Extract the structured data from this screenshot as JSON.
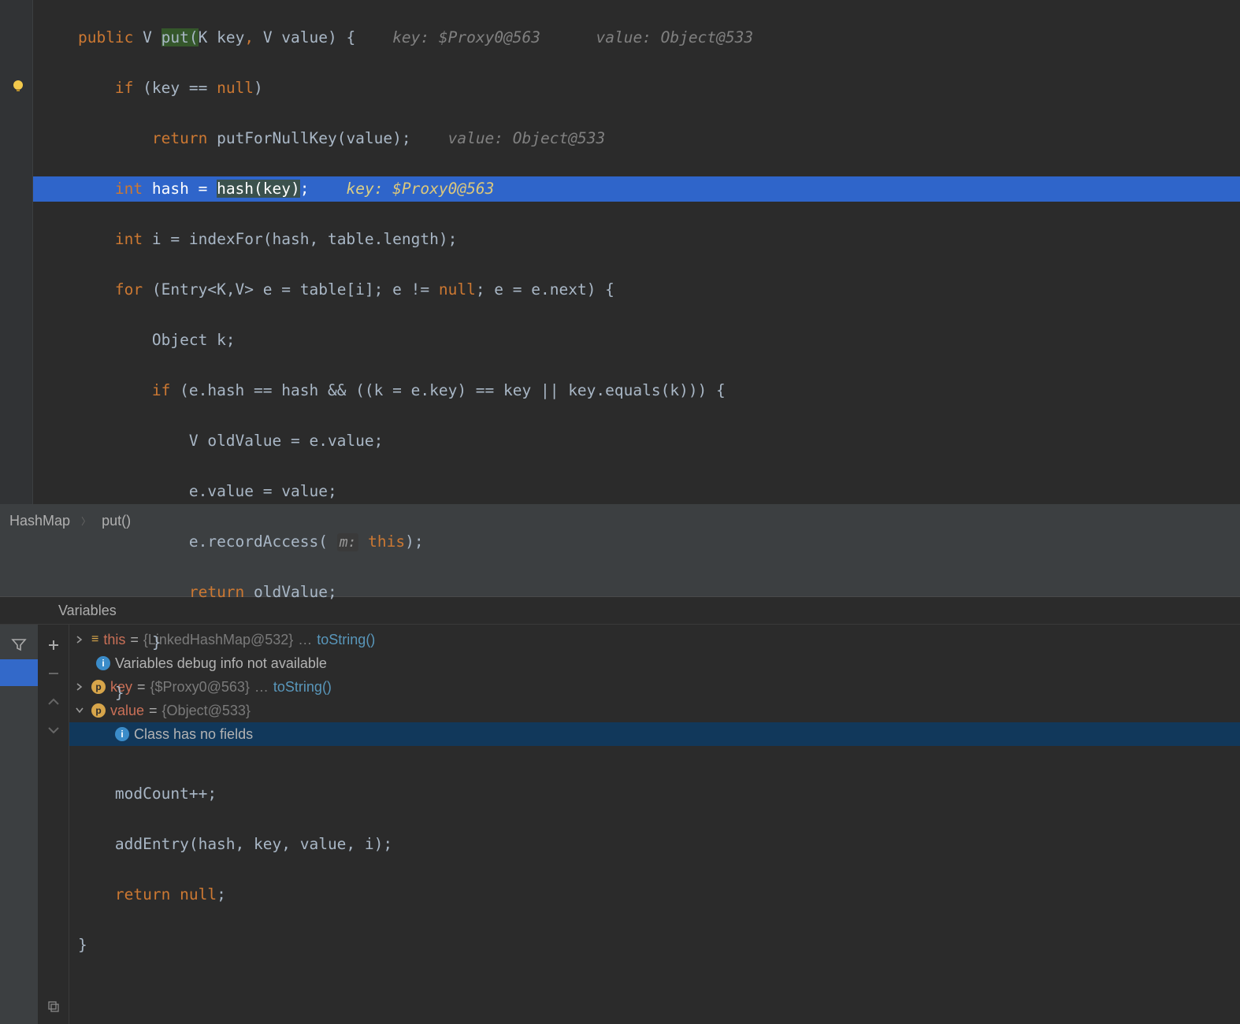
{
  "breadcrumb": {
    "class": "HashMap",
    "method": "put()"
  },
  "gutter": {
    "bulb": "suggestion-bulb"
  },
  "code": {
    "l1": {
      "pre": "    ",
      "kw": "public",
      "t1": " V ",
      "sel": "put(",
      "t2": "K key",
      "comma": ",",
      "t3": " V value) {",
      "hint1a": "key: ",
      "hint1b": "$Proxy0@563",
      "hint2a": "value: ",
      "hint2b": "Object@533"
    },
    "l2": {
      "pre": "        ",
      "kw": "if",
      "t": " (key == ",
      "kw2": "null",
      "t2": ")"
    },
    "l3": {
      "pre": "            ",
      "kw": "return",
      "t": " putForNullKey(value);",
      "hint1a": "value: ",
      "hint1b": "Object@533"
    },
    "l4": {
      "pre": "        ",
      "kw": "int",
      "t": " hash = ",
      "call": "hash(key)",
      "semi": ";",
      "hint1a": "key: ",
      "hint1b": "$Proxy0@563"
    },
    "l5": {
      "pre": "        ",
      "kw": "int",
      "t": " i = indexFor(hash, table.length);"
    },
    "l6": {
      "pre": "        ",
      "kw": "for",
      "t": " (Entry<K,V> e = table[i]; e != ",
      "kw2": "null",
      "t2": "; e = e.next) {"
    },
    "l7": {
      "pre": "            ",
      "t": "Object k;"
    },
    "l8": {
      "pre": "            ",
      "kw": "if",
      "t": " (e.hash == hash && ((k = e.key) == key || key.equals(k))) {"
    },
    "l9": {
      "pre": "                ",
      "t": "V oldValue = e.value;"
    },
    "l10": {
      "pre": "                ",
      "t": "e.value = value;"
    },
    "l11": {
      "pre": "                ",
      "t": "e.recordAccess( ",
      "param": "m:",
      "t2": " ",
      "kw": "this",
      "t3": ");"
    },
    "l12": {
      "pre": "                ",
      "kw": "return",
      "t": " oldValue;"
    },
    "l13": {
      "pre": "            ",
      "t": "}"
    },
    "l14": {
      "pre": "        ",
      "t": "}"
    },
    "l15": {
      "pre": ""
    },
    "l16": {
      "pre": "        ",
      "t": "modCount++;"
    },
    "l17": {
      "pre": "        ",
      "t": "addEntry(hash, key, value, i);"
    },
    "l18": {
      "pre": "        ",
      "kw": "return null",
      "t": ";"
    },
    "l19": {
      "pre": "    ",
      "t": "}"
    }
  },
  "debug": {
    "tab": "Variables",
    "rows": {
      "r1": {
        "name": "this",
        "eq": " = ",
        "val": "{LinkedHashMap@532} ",
        "dots": " … ",
        "link": "toString()"
      },
      "r2": {
        "text": "Variables debug info not available"
      },
      "r3": {
        "name": "key",
        "eq": " = ",
        "val": "{$Proxy0@563} ",
        "dots": " … ",
        "link": "toString()"
      },
      "r4": {
        "name": "value",
        "eq": " = ",
        "val": "{Object@533}"
      },
      "r5": {
        "text": "Class has no fields"
      }
    }
  }
}
